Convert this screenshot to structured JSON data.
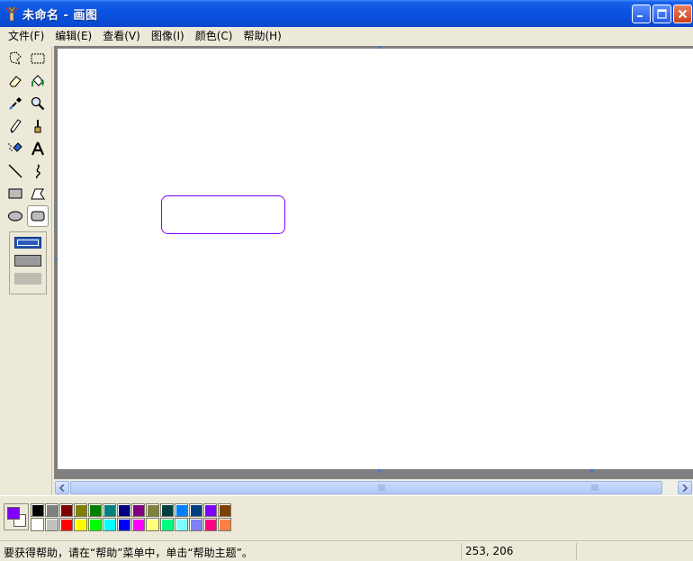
{
  "window": {
    "title": "未命名 - 画图"
  },
  "menu": [
    "文件(F)",
    "编辑(E)",
    "查看(V)",
    "图像(I)",
    "颜色(C)",
    "帮助(H)"
  ],
  "tools": [
    "free-select-icon",
    "rect-select-icon",
    "eraser-icon",
    "fill-bucket-icon",
    "color-picker-icon",
    "magnifier-icon",
    "pencil-icon",
    "brush-icon",
    "airbrush-icon",
    "text-icon",
    "line-icon",
    "curve-icon",
    "rectangle-icon",
    "polygon-icon",
    "ellipse-icon",
    "rounded-rect-icon"
  ],
  "selected_tool": "rounded-rect-icon",
  "colors": {
    "foreground": "#8000ff",
    "background": "#ffffff",
    "palette_row1": [
      "#000000",
      "#808080",
      "#800000",
      "#808000",
      "#008000",
      "#008080",
      "#000080",
      "#800080",
      "#808040",
      "#004040",
      "#0080ff",
      "#004080",
      "#8000ff",
      "#804000"
    ],
    "palette_row2": [
      "#ffffff",
      "#c0c0c0",
      "#ff0000",
      "#ffff00",
      "#00ff00",
      "#00ffff",
      "#0000ff",
      "#ff00ff",
      "#ffff80",
      "#00ff80",
      "#80ffff",
      "#8080ff",
      "#ff0080",
      "#ff8040"
    ]
  },
  "drawing": {
    "shape": "rounded-rectangle",
    "stroke": "#8000ff"
  },
  "status": {
    "message": "要获得帮助，请在“帮助”菜单中，单击“帮助主题”。",
    "coordinates": "253, 206"
  }
}
